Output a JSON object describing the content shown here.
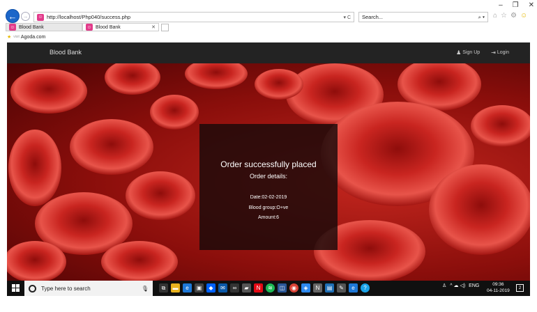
{
  "window": {
    "minimize": "–",
    "restore": "❐",
    "close": "✕"
  },
  "browser": {
    "back_glyph": "←",
    "forward_glyph": "→",
    "url": "http://localhost/Php040/success.php",
    "address_controls": "▾ C",
    "search_placeholder": "Search...",
    "search_controls": "⌕ ▾",
    "tabs": [
      {
        "label": "Blood Bank"
      },
      {
        "label": "Blood Bank",
        "close": "✕"
      }
    ],
    "favorites": {
      "visited": "visit",
      "item": "Agoda.com"
    }
  },
  "site": {
    "brand": "Blood Bank",
    "signup": "Sign Up",
    "login": "Login"
  },
  "order": {
    "title": "Order successfully placed",
    "subtitle": "Order details:",
    "date": "Date:02-02-2019",
    "blood_group": "Blood group:O+ve",
    "amount": "Amount:6"
  },
  "taskbar": {
    "search_placeholder": "Type here to search",
    "lang": "ENG",
    "time": "09:36",
    "date": "04-11-2019",
    "notifications": "2",
    "tray_glyphs": "^ ☁ ◁)"
  },
  "colors": {
    "navbar": "#232323",
    "accent_blood": "#b3181a",
    "card": "#190a0a"
  }
}
